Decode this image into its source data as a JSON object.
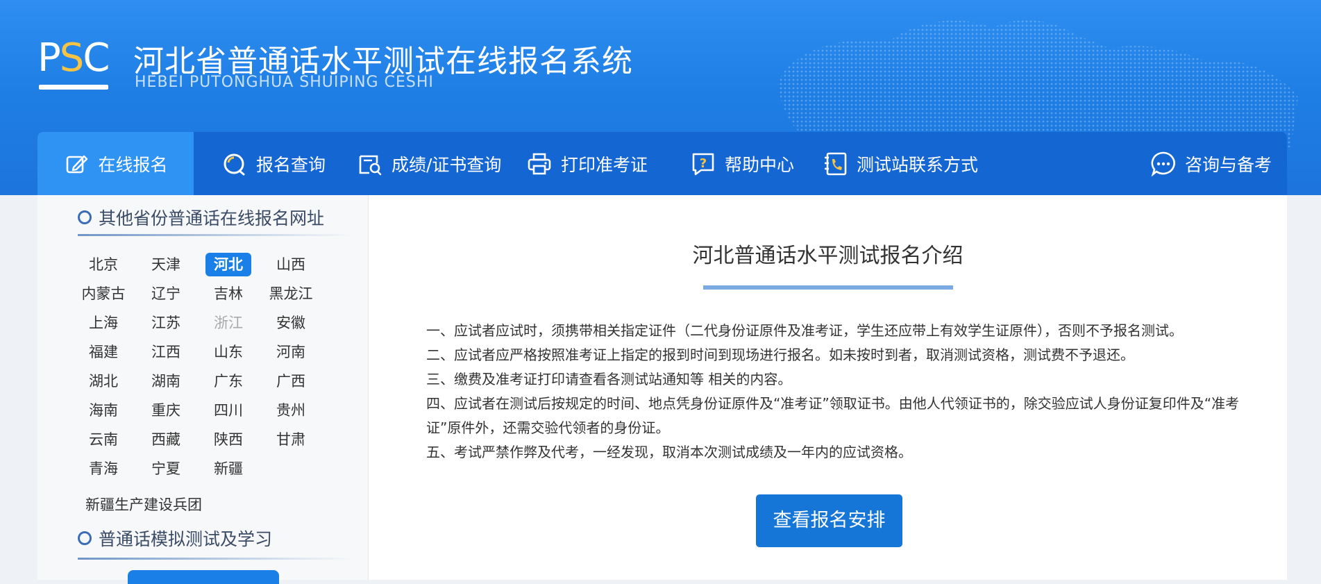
{
  "header": {
    "logo": {
      "p": "P",
      "s": "S",
      "c": "C"
    },
    "title": "河北省普通话水平测试在线报名系统",
    "subtitle": "HEBEI PUTONGHUA SHUIPING CESHI"
  },
  "nav": {
    "items": [
      {
        "label": "在线报名",
        "icon": "edit-icon"
      },
      {
        "label": "报名查询",
        "icon": "search-icon"
      },
      {
        "label": "成绩/证书查询",
        "icon": "certificate-search-icon"
      },
      {
        "label": "打印准考证",
        "icon": "printer-icon"
      },
      {
        "label": "帮助中心",
        "icon": "help-icon"
      },
      {
        "label": "测试站联系方式",
        "icon": "phone-icon"
      },
      {
        "label": "咨询与备考",
        "icon": "chat-icon"
      }
    ]
  },
  "sidebar": {
    "provinces_title": "其他省份普通话在线报名网址",
    "provinces": [
      [
        "北京",
        "天津",
        "河北",
        "山西"
      ],
      [
        "内蒙古",
        "辽宁",
        "吉林",
        "黑龙江"
      ],
      [
        "上海",
        "江苏",
        "浙江",
        "安徽"
      ],
      [
        "福建",
        "江西",
        "山东",
        "河南"
      ],
      [
        "湖北",
        "湖南",
        "广东",
        "广西"
      ],
      [
        "海南",
        "重庆",
        "四川",
        "贵州"
      ],
      [
        "云南",
        "西藏",
        "陕西",
        "甘肃"
      ],
      [
        "青海",
        "宁夏",
        "新疆"
      ]
    ],
    "active_province": "河北",
    "disabled_province": "浙江",
    "bingtuan": "新疆生产建设兵团",
    "practice_title": "普通话模拟测试及学习"
  },
  "main": {
    "title": "河北普通话水平测试报名介绍",
    "paragraphs": [
      "一、应试者应试时，须携带相关指定证件（二代身份证原件及准考证，学生还应带上有效学生证原件），否则不予报名测试。",
      "二、应试者应严格按照准考证上指定的报到时间到现场进行报名。如未按时到者，取消测试资格，测试费不予退还。",
      "三、缴费及准考证打印请查看各测试站通知等 相关的内容。",
      "四、应试者在测试后按规定的时间、地点凭身份证原件及“准考证”领取证书。由他人代领证书的，除交验应试人身份证复印件及“准考证”原件外，还需交验代领者的身份证。",
      "五、考试严禁作弊及代考，一经发现，取消本次测试成绩及一年内的应试资格。"
    ],
    "button": "查看报名安排"
  },
  "colors": {
    "brand_blue": "#1466d2",
    "active_tab": "#2f93f3",
    "logo_accent": "#f6c343"
  }
}
